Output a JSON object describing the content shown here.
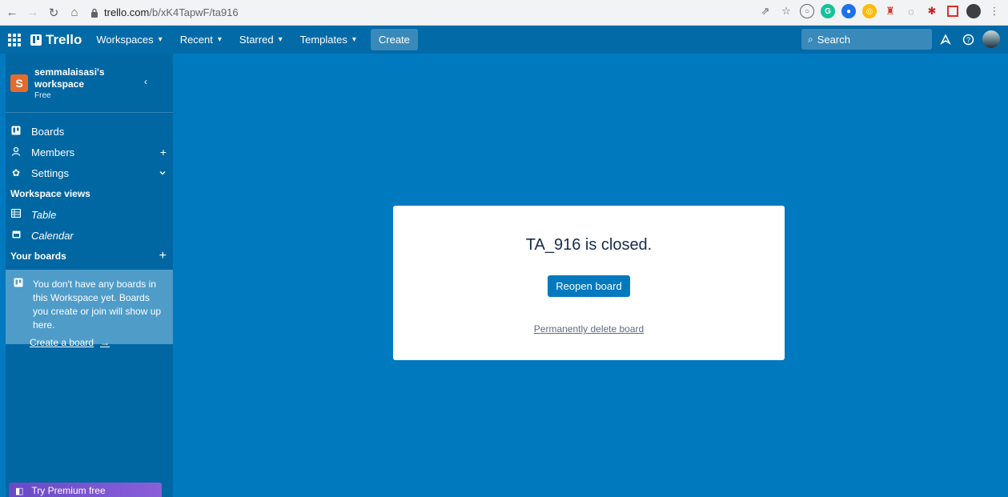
{
  "browser": {
    "url_host": "trello.com",
    "url_path": "/b/xK4TapwF/ta916",
    "nav_icons": [
      "back-arrow-icon",
      "forward-arrow-icon",
      "reload-icon",
      "home-icon"
    ],
    "extension_icons": [
      "share-icon",
      "star-icon",
      "extension-icon",
      "grammarly-icon",
      "extension-icon",
      "extension-icon",
      "extension-icon",
      "extension-icon",
      "puzzle-icon",
      "sidebar-icon",
      "profile-icon",
      "menu-icon"
    ]
  },
  "header": {
    "logo_text": "Trello",
    "menu": [
      {
        "label": "Workspaces"
      },
      {
        "label": "Recent"
      },
      {
        "label": "Starred"
      },
      {
        "label": "Templates"
      }
    ],
    "create_label": "Create",
    "search_placeholder": "Search",
    "colors": {
      "header_bg": "#026aa7",
      "board_bg": "#0079bf"
    }
  },
  "sidebar": {
    "workspace_initial": "S",
    "workspace_name_line1": "semmalaisasi's",
    "workspace_name_line2": "workspace",
    "workspace_plan": "Free",
    "items": [
      {
        "label": "Boards",
        "icon": "board-icon"
      },
      {
        "label": "Members",
        "icon": "members-icon",
        "action": "+"
      },
      {
        "label": "Settings",
        "icon": "settings-icon",
        "action": "chevron-down"
      }
    ],
    "views_heading": "Workspace views",
    "views": [
      {
        "label": "Table",
        "icon": "table-icon"
      },
      {
        "label": "Calendar",
        "icon": "calendar-icon"
      }
    ],
    "your_boards_heading": "Your boards",
    "empty_message": "You don't have any boards in this Workspace yet. Boards you create or join will show up here.",
    "create_board_link": "Create a board",
    "premium_label": "Try Premium free",
    "colors": {
      "sidebar_bg": "#0067a3",
      "workspace_avatar": "#e56b2c",
      "premium": "#6a49c6"
    }
  },
  "modal": {
    "title": "TA_916 is closed.",
    "reopen_label": "Reopen board",
    "delete_label": "Permanently delete board"
  }
}
